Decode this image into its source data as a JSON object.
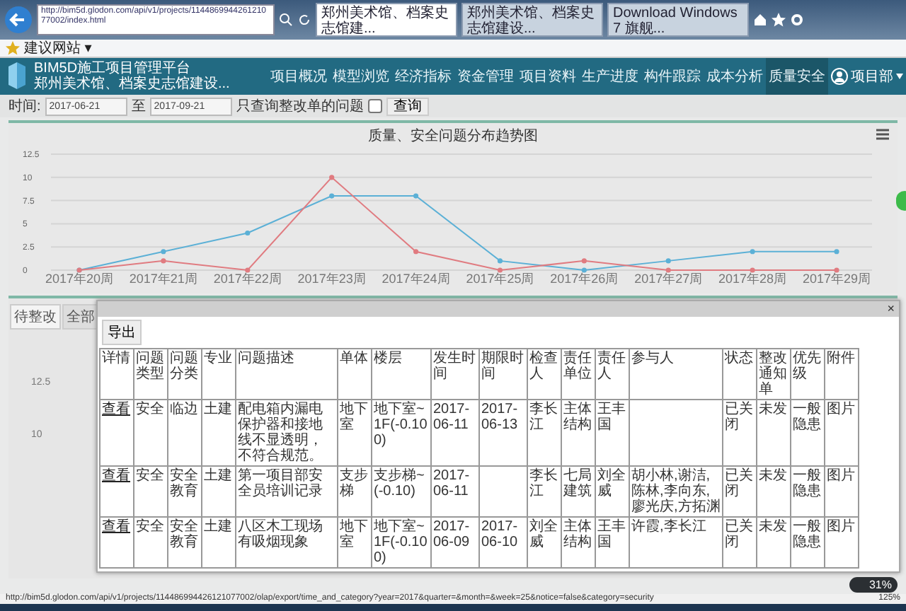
{
  "browser": {
    "url": "http://bim5d.glodon.com/api/v1/projects/114486994426121077002/index.html",
    "tabs": [
      {
        "title": "郑州美术馆、档案史志馆建...",
        "selected": true
      },
      {
        "title": "郑州美术馆、档案史志馆建设...",
        "selected": false
      },
      {
        "title": "Download Windows 7 旗舰...",
        "selected": false
      }
    ],
    "favorites": [
      {
        "label": "建议网站 ▾"
      }
    ],
    "status_url": "http://bim5d.glodon.com/api/v1/projects/114486994426121077002/olap/export/time_and_category?year=2017&quarter=&month=&week=25&notice=false&category=security",
    "zoom": "125%"
  },
  "header": {
    "title": "BIM5D施工项目管理平台",
    "subtitle": "郑州美术馆、档案史志馆建设...",
    "user": "项目部"
  },
  "nav": [
    {
      "label": "项目概况",
      "selected": false
    },
    {
      "label": "模型浏览",
      "selected": false
    },
    {
      "label": "经济指标",
      "selected": false
    },
    {
      "label": "资金管理",
      "selected": false
    },
    {
      "label": "项目资料",
      "selected": false
    },
    {
      "label": "生产进度",
      "selected": false
    },
    {
      "label": "构件跟踪",
      "selected": false
    },
    {
      "label": "成本分析",
      "selected": false
    },
    {
      "label": "质量安全",
      "selected": true
    }
  ],
  "filter": {
    "label": "时间:",
    "from": "2017-06-21",
    "to_label": "至",
    "to": "2017-09-21",
    "checkbox": {
      "label": "只查询整改单的问题",
      "checked": false
    },
    "button": "查询"
  },
  "chart_panel": {
    "chart_data": {
      "type": "line",
      "title": "质量、安全问题分布趋势图",
      "categories": [
        "2017年20周",
        "2017年21周",
        "2017年22周",
        "2017年23周",
        "2017年24周",
        "2017年25周",
        "2017年26周",
        "2017年27周",
        "2017年28周",
        "2017年29周"
      ],
      "yticks": [
        0,
        {
          "value": 2.5,
          "label": "2.5"
        },
        {
          "value": 5,
          "label": "5"
        },
        {
          "value": 7.5,
          "label": "7.5"
        },
        {
          "value": 10,
          "label": "10"
        },
        {
          "value": 12.5,
          "label": "12.5"
        }
      ],
      "ylim": [
        0,
        12.5
      ],
      "grid": true,
      "series": [
        {
          "color": "#5bb0d6",
          "marker": "circle",
          "values": [
            0,
            2,
            4,
            8,
            8,
            1,
            0,
            1,
            2,
            2
          ]
        },
        {
          "color": "#e07b80",
          "marker": "circle",
          "values": [
            0,
            1,
            0,
            10,
            2,
            0,
            1,
            0,
            0,
            0
          ]
        }
      ]
    }
  },
  "lower_panel": {
    "tabs": [
      {
        "label": "待整改",
        "selected": true
      },
      {
        "label": "全部",
        "selected": false
      }
    ],
    "axis_labels": [
      "12.5",
      "10"
    ]
  },
  "modal": {
    "close": "×",
    "export_button": "导出",
    "columns": [
      "详情",
      "问题类型",
      "问题分类",
      "专业",
      "问题描述",
      "单体",
      "楼层",
      "发生时间",
      "期限时间",
      "检查人",
      "责任单位",
      "责任人",
      "参与人",
      "状态",
      "整改通知单",
      "优先级",
      "附件"
    ],
    "rows": [
      [
        "查看",
        "安全",
        "临边",
        "土建",
        "配电箱内漏电保护器和接地线不显透明，不符合规范。",
        "地下室",
        "地下室~1F(-0.100)",
        "2017-06-11",
        "2017-06-13",
        "李长江",
        "主体结构",
        "王丰国",
        "",
        "已关闭",
        "未发",
        "一般隐患",
        "图片"
      ],
      [
        "查看",
        "安全",
        "安全教育",
        "土建",
        "第一项目部安全员培训记录",
        "支步梯",
        "支步梯~(-0.10)",
        "2017-06-11",
        "",
        "李长江",
        "七局建筑",
        "刘全威",
        "胡小林,谢洁,陈林,李向东,廖光庆,方拓渊",
        "已关闭",
        "未发",
        "一般隐患",
        "图片"
      ],
      [
        "查看",
        "安全",
        "安全教育",
        "土建",
        "八区木工现场有吸烟现象",
        "地下室",
        "地下室~1F(-0.100)",
        "2017-06-09",
        "2017-06-10",
        "刘全威",
        "主体结构",
        "王丰国",
        "许霞,李长江",
        "已关闭",
        "未发",
        "一般隐患",
        "图片"
      ]
    ]
  },
  "status_badge": true,
  "speed_meter": "31%"
}
